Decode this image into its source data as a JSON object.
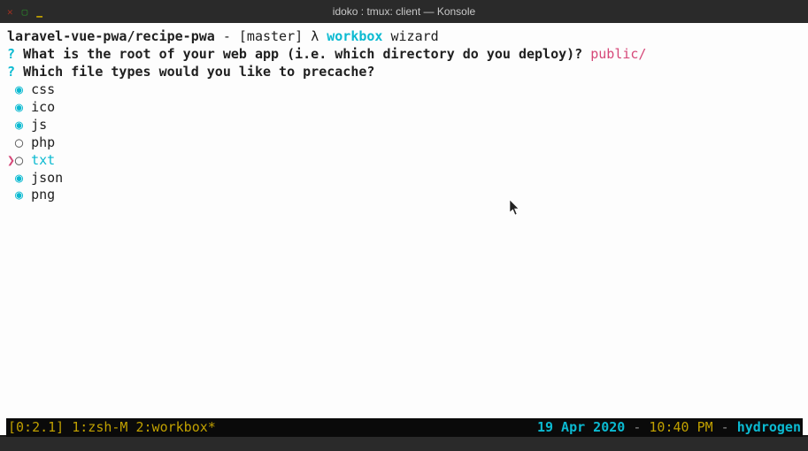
{
  "window": {
    "title": "idoko : tmux: client — Konsole"
  },
  "prompt": {
    "path": "laravel-vue-pwa/recipe-pwa",
    "branch": "[master]",
    "symbol": "λ",
    "command": "workbox",
    "args": "wizard"
  },
  "q1": {
    "marker": "?",
    "text": "What is the root of your web app (i.e. which directory do you deploy)?",
    "answer": "public/"
  },
  "q2": {
    "marker": "?",
    "text": "Which file types would you like to precache?"
  },
  "options": {
    "css": {
      "label": "css",
      "selected_glyph": "◉"
    },
    "ico": {
      "label": "ico",
      "selected_glyph": "◉"
    },
    "js": {
      "label": "js",
      "selected_glyph": "◉"
    },
    "php": {
      "label": "php",
      "unselected_glyph": "◯"
    },
    "txt": {
      "label": "txt",
      "cursor_glyph": "❯",
      "unselected_glyph": "◯"
    },
    "json": {
      "label": "json",
      "selected_glyph": "◉"
    },
    "png": {
      "label": "png",
      "selected_glyph": "◉"
    }
  },
  "status": {
    "session": "[0:2.1]",
    "win1": "1:zsh-M",
    "win2": "2:workbox*",
    "date": "19 Apr 2020",
    "sep": " - ",
    "time": "10:40 PM",
    "host": "hydrogen"
  }
}
